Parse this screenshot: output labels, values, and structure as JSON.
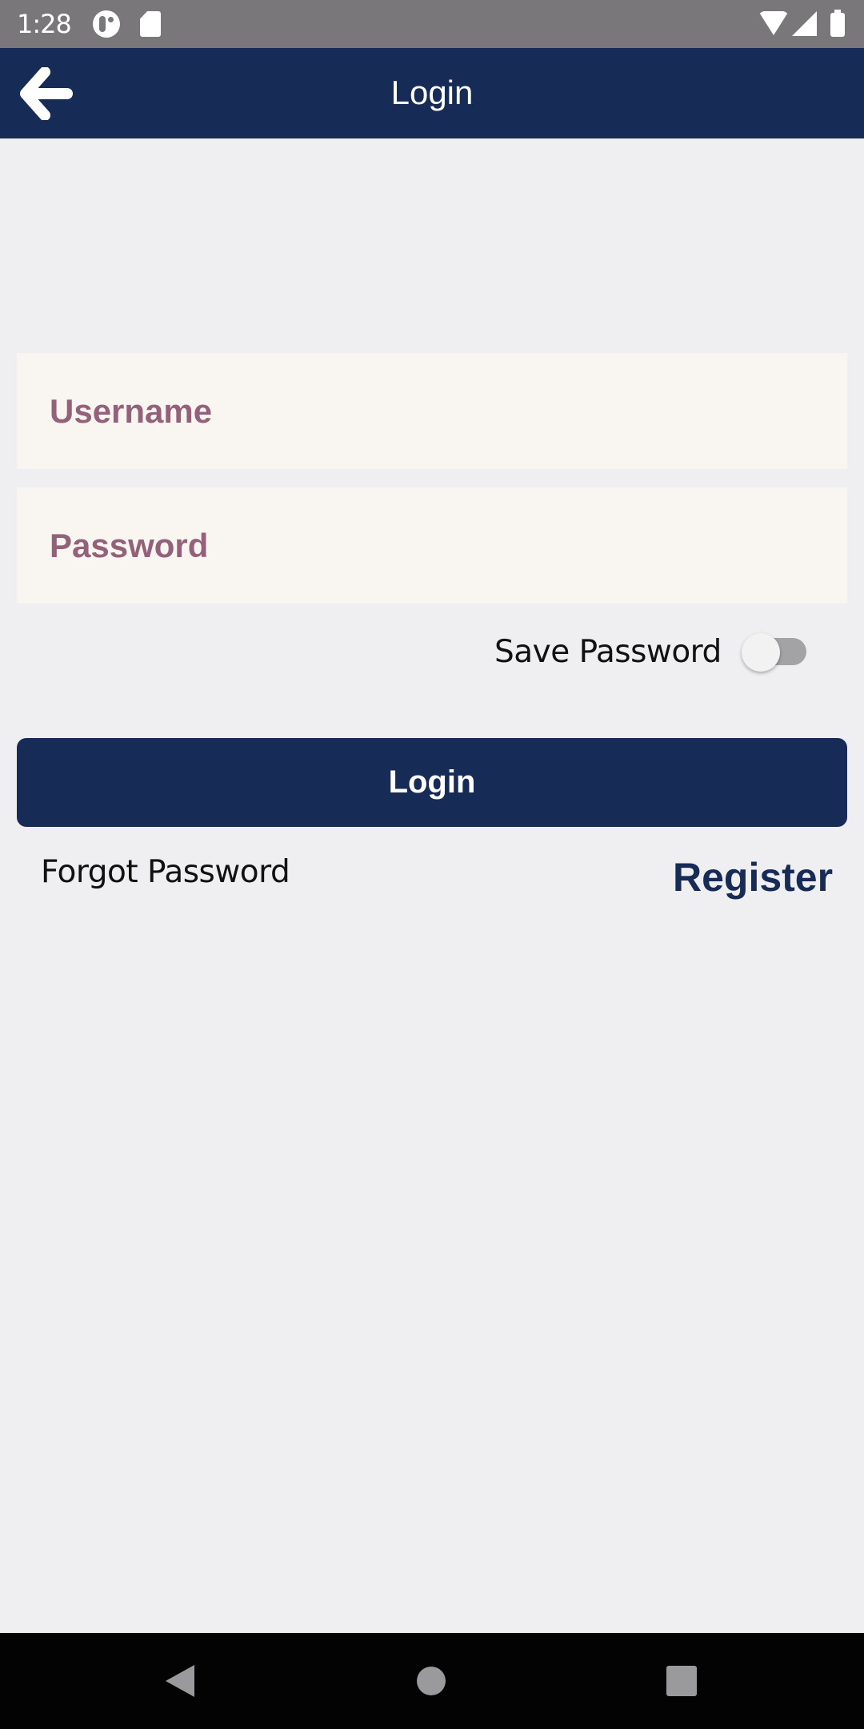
{
  "status_bar": {
    "time": "1:28",
    "left_icons": [
      "app-notification-icon",
      "sd-card-icon"
    ],
    "right_icons": [
      "wifi-icon",
      "cell-signal-icon",
      "battery-icon"
    ]
  },
  "app_bar": {
    "back_icon": "arrow-left-icon",
    "title": "Login"
  },
  "form": {
    "username": {
      "value": "",
      "placeholder": "Username"
    },
    "password": {
      "value": "",
      "placeholder": "Password"
    },
    "save_password": {
      "label": "Save Password",
      "checked": false
    },
    "login_button": "Login",
    "forgot_password": "Forgot Password",
    "register": "Register"
  },
  "nav_bar": {
    "buttons": [
      "back",
      "home",
      "recents"
    ]
  },
  "colors": {
    "primary": "#162b55",
    "placeholder": "#93627a",
    "field_background": "#f9f6f1",
    "page_background": "#efeef1"
  }
}
